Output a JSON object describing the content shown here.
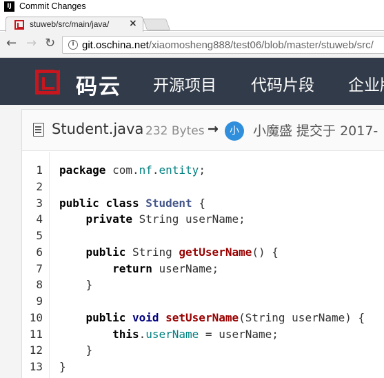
{
  "window": {
    "title": "Commit Changes",
    "app_icon_letter": "IJ"
  },
  "browser": {
    "tab_title": "stuweb/src/main/java/",
    "tab_close": "×",
    "url_host": "git.oschina.net",
    "url_path": "/xiaomosheng888/test06/blob/master/stuweb/src/",
    "back_glyph": "←",
    "forward_glyph": "→",
    "reload_glyph": "↻",
    "info_glyph": "i"
  },
  "site": {
    "logo_text": "码云",
    "brand_color": "#c7161e",
    "header_bg": "#323b49",
    "nav": [
      "开源项目",
      "代码片段",
      "企业版"
    ]
  },
  "file": {
    "name": "Student.java",
    "size": "232 Bytes",
    "arrow": "→",
    "avatar_letter": "小",
    "commit_meta": "小魔盛 提交于 2017-"
  },
  "code": {
    "line_numbers": [
      "1",
      "2",
      "3",
      "4",
      "5",
      "6",
      "7",
      "8",
      "9",
      "10",
      "11",
      "12",
      "13"
    ],
    "lines": [
      [
        {
          "c": "k2",
          "t": "package"
        },
        {
          "c": "t",
          "t": " com."
        },
        {
          "c": "p",
          "t": "nf"
        },
        {
          "c": "t",
          "t": "."
        },
        {
          "c": "p",
          "t": "entity"
        },
        {
          "c": "t",
          "t": ";"
        }
      ],
      [],
      [
        {
          "c": "k2",
          "t": "public"
        },
        {
          "c": "t",
          "t": " "
        },
        {
          "c": "k2",
          "t": "class"
        },
        {
          "c": "t",
          "t": " "
        },
        {
          "c": "c",
          "t": "Student"
        },
        {
          "c": "t",
          "t": " {"
        }
      ],
      [
        {
          "c": "t",
          "t": "    "
        },
        {
          "c": "k2",
          "t": "private"
        },
        {
          "c": "t",
          "t": " String userName;"
        }
      ],
      [],
      [
        {
          "c": "t",
          "t": "    "
        },
        {
          "c": "k2",
          "t": "public"
        },
        {
          "c": "t",
          "t": " String "
        },
        {
          "c": "f",
          "t": "getUserName"
        },
        {
          "c": "t",
          "t": "() {"
        }
      ],
      [
        {
          "c": "t",
          "t": "        "
        },
        {
          "c": "k2",
          "t": "return"
        },
        {
          "c": "t",
          "t": " userName;"
        }
      ],
      [
        {
          "c": "t",
          "t": "    }"
        }
      ],
      [],
      [
        {
          "c": "t",
          "t": "    "
        },
        {
          "c": "k2",
          "t": "public"
        },
        {
          "c": "t",
          "t": " "
        },
        {
          "c": "k",
          "t": "void"
        },
        {
          "c": "t",
          "t": " "
        },
        {
          "c": "f",
          "t": "setUserName"
        },
        {
          "c": "t",
          "t": "(String userName) {"
        }
      ],
      [
        {
          "c": "t",
          "t": "        "
        },
        {
          "c": "k2",
          "t": "this"
        },
        {
          "c": "t",
          "t": "."
        },
        {
          "c": "p",
          "t": "userName"
        },
        {
          "c": "t",
          "t": " = userName;"
        }
      ],
      [
        {
          "c": "t",
          "t": "    }"
        }
      ],
      [
        {
          "c": "t",
          "t": "}"
        }
      ]
    ]
  }
}
